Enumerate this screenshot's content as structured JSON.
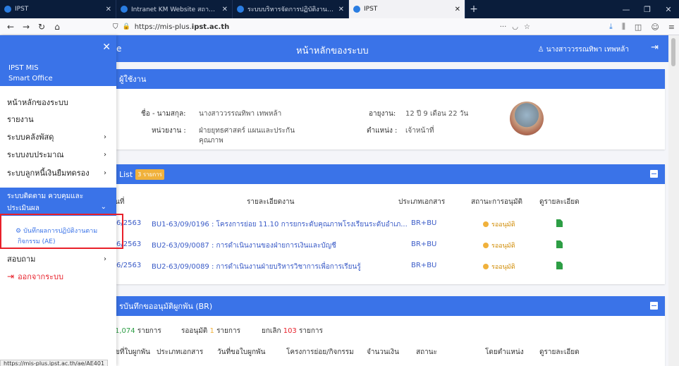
{
  "browser": {
    "tabs": [
      {
        "title": "IPST",
        "active": false
      },
      {
        "title": "Intranet KM Website สถาบันส่งเสริมการสอน...",
        "active": false
      },
      {
        "title": "ระบบบริหารจัดการปฏิบัติงานตามกิจกรรม",
        "active": false
      },
      {
        "title": "IPST",
        "active": true
      }
    ],
    "url_prefix": "https://mis-plus.",
    "url_domain": "ipst.ac.th",
    "status_url": "https://mis-plus.ipst.ac.th/ae/AE401"
  },
  "header": {
    "left_fragment": "e",
    "title": "หน้าหลักของระบบ",
    "user": "นางสาววรรณทิพา เทพหล้า"
  },
  "sidebar": {
    "brand_line1": "IPST MIS",
    "brand_line2": "Smart Office",
    "items": [
      {
        "label": "หน้าหลักของระบบ",
        "chevron": ""
      },
      {
        "label": "รายงาน",
        "chevron": ""
      },
      {
        "label": "ระบบคลังพัสดุ",
        "chevron": "›"
      },
      {
        "label": "ระบบงบประมาณ",
        "chevron": "›"
      },
      {
        "label": "ระบบลูกหนี้เงินยืมทดรอง",
        "chevron": "›"
      }
    ],
    "active_line1": "ระบบติดตาม ควบคุมและ",
    "active_line2": "ประเมินผล",
    "active_chevron": "⌄",
    "sub_line1": "บันทึกผลการปฏิบัติงานตาม",
    "sub_line2": "กิจกรรม (AE)",
    "after_item": {
      "label": "สอบถาม",
      "chevron": "›"
    },
    "logout": "ออกจากระบบ"
  },
  "user_card": {
    "title_fragment": "ผู้ใช้งาน",
    "name_label": "ชื่อ - นามสกุล:",
    "name_value": "นางสาววรรณทิพา เทพหล้า",
    "dept_label": "หน่วยงาน :",
    "dept_value_1": "ฝ่ายยุทธศาสตร์ แผนและประกัน",
    "dept_value_2": "คุณภาพ",
    "age_label": "อายุงาน:",
    "age_value": "12 ปี 9 เดือน 22 วัน",
    "pos_label": "ตำแหน่ง :",
    "pos_value": "เจ้าหน้าที่"
  },
  "list_card": {
    "title_fragment": "List",
    "badge": "3 รายการ",
    "columns": [
      "นที่",
      "รายละเอียดงาน",
      "ประเภทเอกสาร",
      "สถานะการอนุมัติ",
      "ดูรายละเอียด"
    ],
    "rows": [
      {
        "date": "6/2563",
        "detail": "BU1-63/09/0196 : โครงการย่อย 11.10 การยกระดับคุณภาพโรงเรียนระดับอำเภ...",
        "doctype": "BR+BU",
        "status": "รออนุมัติ"
      },
      {
        "date": "6/2563",
        "detail": "BU2-63/09/0087 : การดำเนินงานของฝ่ายการเงินและบัญชี",
        "doctype": "BR+BU",
        "status": "รออนุมัติ"
      },
      {
        "date": "6/2563",
        "detail": "BU2-63/09/0089 : การดำเนินงานฝ่ายบริหารวิชาการเพื่อการเรียนรู้",
        "doctype": "BR+BU",
        "status": "รออนุมัติ"
      }
    ]
  },
  "br_card": {
    "title": "รบันทึกขออนุมัติผูกพัน (BR)",
    "summary_count": "1,074",
    "summary_unit": "รายการ",
    "pending_label": "รออนุมัติ",
    "pending_count": "1",
    "pending_unit": "รายการ",
    "cancel_label": "ยกเลิก",
    "cancel_count": "103",
    "cancel_unit": "รายการ",
    "columns": [
      "ขที่ใบผูกพัน",
      "ประเภทเอกสาร",
      "วันที่ขอใบผูกพัน",
      "โครงการย่อย/กิจกรรม",
      "จำนวนเงิน",
      "สถานะ",
      "โดยตำแหน่ง",
      "ดูรายละเอียด"
    ]
  },
  "colors": {
    "primary": "#3a73e8",
    "pending": "#f0b13c",
    "danger": "#e8202a",
    "file": "#2d9e45"
  }
}
